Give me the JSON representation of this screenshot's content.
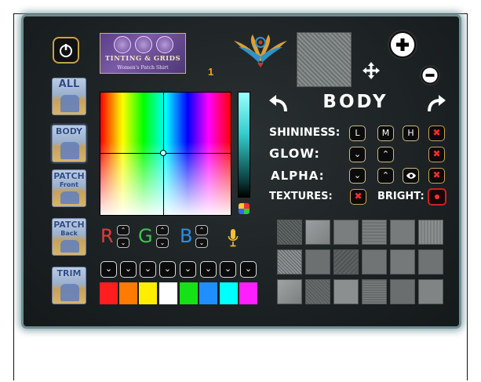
{
  "header": {
    "logo_line1": "TINTING & GRIDS",
    "logo_line2": "Women's Patch Shirt",
    "item_number": "1"
  },
  "sidebar": {
    "items": [
      {
        "label": "ALL",
        "sub": ""
      },
      {
        "label": "BODY",
        "sub": ""
      },
      {
        "label": "PATCH",
        "sub": "Front"
      },
      {
        "label": "PATCH",
        "sub": "Back"
      },
      {
        "label": "TRIM",
        "sub": ""
      }
    ]
  },
  "section": {
    "title": "BODY"
  },
  "properties": {
    "shininess": {
      "label": "SHININESS:",
      "low": "L",
      "medium": "M",
      "high": "H"
    },
    "glow": {
      "label": "GLOW:"
    },
    "alpha": {
      "label": "ALPHA:"
    },
    "textures": {
      "label": "TEXTURES:"
    },
    "bright": {
      "label": "BRIGHT:"
    }
  },
  "rgb": {
    "r": "R",
    "g": "G",
    "b": "B"
  },
  "colors": {
    "accent": "#c9a04a",
    "rgb_r": "#e33b3b",
    "rgb_g": "#3cc64a",
    "rgb_b": "#2f8de0",
    "swatches": [
      "#ff1e1e",
      "#ff7a00",
      "#ffee00",
      "#ffffff",
      "#16e016",
      "#1f8fff",
      "#00ffff",
      "#ff1eff"
    ]
  },
  "icons": [
    "power-icon",
    "plus-icon",
    "minus-icon",
    "move-icon",
    "undo-icon",
    "redo-icon",
    "eye-icon",
    "microphone-icon",
    "chevron-down-icon",
    "chevron-up-icon",
    "close-icon"
  ]
}
